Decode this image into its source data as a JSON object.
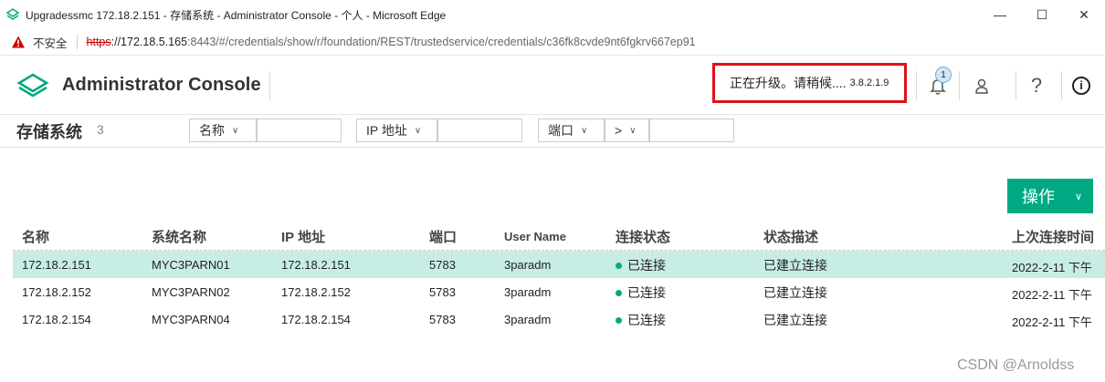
{
  "window": {
    "title": "Upgradessmc 172.18.2.151 - 存储系统 - Administrator Console - 个人 - Microsoft Edge",
    "minimize": "—",
    "maximize": "☐",
    "close": "✕"
  },
  "address": {
    "insecure_label": "不安全",
    "scheme": "https",
    "host": "://172.18.5.165",
    "rest": ":8443/#/credentials/show/r/foundation/REST/trustedservice/credentials/c36fk8cvde9nt6fgkrv667ep91"
  },
  "header": {
    "app_title": "Administrator Console",
    "upgrade_text": "正在升级。请稍候....",
    "upgrade_version": "3.8.2.1.9",
    "notification_count": "1",
    "help_glyph": "?",
    "info_glyph": "i"
  },
  "filters": {
    "page_title": "存储系统",
    "count": "3",
    "name_select": "名称",
    "ip_select": "IP 地址",
    "port_select": "端口",
    "op_select": ">"
  },
  "actions": {
    "label": "操作"
  },
  "table": {
    "headers": {
      "name": "名称",
      "system_name": "系统名称",
      "ip": "IP 地址",
      "port": "端口",
      "user": "User Name",
      "conn_status": "连接状态",
      "status_desc": "状态描述",
      "last_conn": "上次连接时间"
    },
    "rows": [
      {
        "name": "172.18.2.151",
        "system_name": "MYC3PARN01",
        "ip": "172.18.2.151",
        "port": "5783",
        "user": "3paradm",
        "conn_status": "已连接",
        "status_desc": "已建立连接",
        "last_conn": "2022-2-11 下午"
      },
      {
        "name": "172.18.2.152",
        "system_name": "MYC3PARN02",
        "ip": "172.18.2.152",
        "port": "5783",
        "user": "3paradm",
        "conn_status": "已连接",
        "status_desc": "已建立连接",
        "last_conn": "2022-2-11 下午"
      },
      {
        "name": "172.18.2.154",
        "system_name": "MYC3PARN04",
        "ip": "172.18.2.154",
        "port": "5783",
        "user": "3paradm",
        "conn_status": "已连接",
        "status_desc": "已建立连接",
        "last_conn": "2022-2-11 下午"
      }
    ]
  },
  "watermark": "CSDN @Arnoldss",
  "colors": {
    "accent": "#01a982",
    "selected_row": "#c8ede4",
    "highlight_border": "#e0101a"
  }
}
